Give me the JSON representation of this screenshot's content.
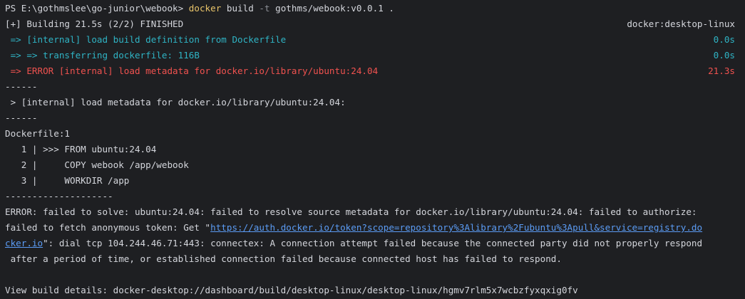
{
  "prompt": {
    "ps": "PS E:\\gothmslee\\go-junior\\webook> ",
    "cmd": "docker",
    "sub": " build ",
    "flag": "-t",
    "args": " gothms/webook:v0.0.1 ."
  },
  "build_status": {
    "text": "[+] Building 21.5s (2/2) FINISHED",
    "context": "docker:desktop-linux"
  },
  "steps": [
    {
      "text": " => [internal] load build definition from Dockerfile",
      "time": "0.0s"
    },
    {
      "text": " => => transferring dockerfile: 116B",
      "time": "0.0s"
    },
    {
      "text": " => ERROR [internal] load metadata for docker.io/library/ubuntu:24.04",
      "time": "21.3s"
    }
  ],
  "sep_short_1": "------",
  "failed_step": " > [internal] load metadata for docker.io/library/ubuntu:24.04:",
  "sep_short_2": "------",
  "dockerfile_ref": "Dockerfile:1",
  "dockerfile_lines": [
    "   1 | >>> FROM ubuntu:24.04",
    "   2 |     COPY webook /app/webook",
    "   3 |     WORKDIR /app"
  ],
  "sep_long": "--------------------",
  "error": {
    "line1": "ERROR: failed to solve: ubuntu:24.04: failed to resolve source metadata for docker.io/library/ubuntu:24.04: failed to authorize:",
    "line2_prefix": "failed to fetch anonymous token: Get \"",
    "url_part1": "https://auth.docker.io/token?scope=repository%3Alibrary%2Fubuntu%3Apull&service=registry.do",
    "url_part2": "cker.io",
    "line3_suffix": "\": dial tcp 104.244.46.71:443: connectex: A connection attempt failed because the connected party did not properly respond",
    "line4": " after a period of time, or established connection failed because connected host has failed to respond."
  },
  "view_details": "View build details: docker-desktop://dashboard/build/desktop-linux/desktop-linux/hgmv7rlm5x7wcbzfyxqxig0fv"
}
